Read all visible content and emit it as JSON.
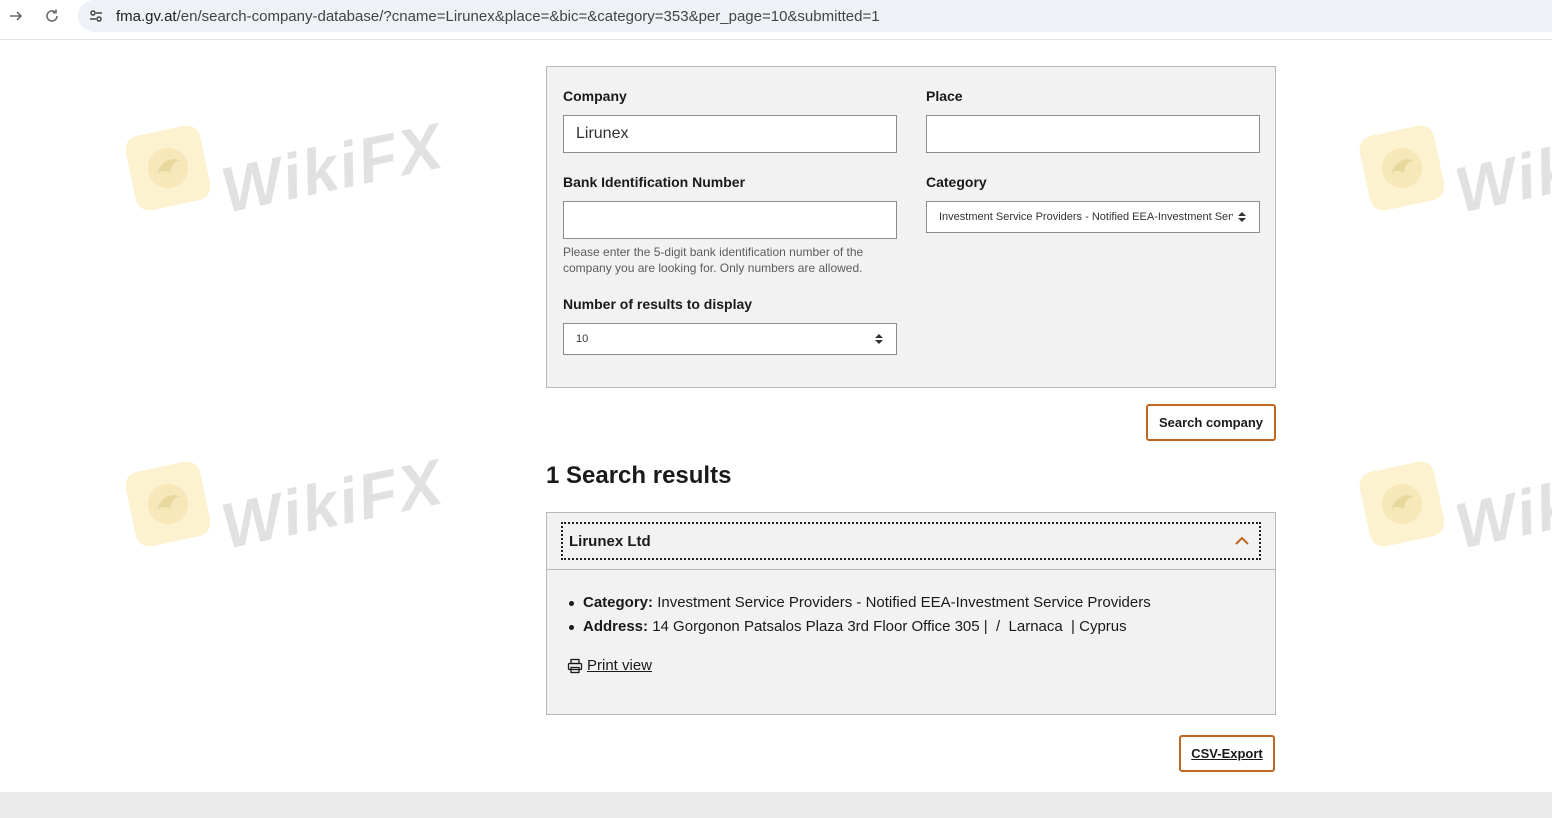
{
  "browser": {
    "url_host": "fma.gv.at",
    "url_path": "/en/search-company-database/?cname=Lirunex&place=&bic=&category=353&per_page=10&submitted=1"
  },
  "form": {
    "company_label": "Company",
    "company_value": "Lirunex",
    "place_label": "Place",
    "place_value": "",
    "bic_label": "Bank Identification Number",
    "bic_value": "",
    "bic_help": "Please enter the 5-digit bank identification number of the company you are looking for. Only numbers are allowed.",
    "category_label": "Category",
    "category_selected": "Investment Service Providers - Notified EEA-Investment Service Providers",
    "results_count_label": "Number of results to display",
    "results_count_selected": "10",
    "search_button": "Search company"
  },
  "results": {
    "title": "1 Search results",
    "items": [
      {
        "name": "Lirunex Ltd",
        "category_label": "Category:",
        "category_value": "Investment Service Providers - Notified EEA-Investment Service Providers",
        "address_label": "Address:",
        "address_value": "14 Gorgonon Patsalos Plaza 3rd Floor Office 305 |  /  Larnaca  | Cyprus",
        "print_label": "Print view"
      }
    ],
    "csv_button": "CSV-Export"
  },
  "watermark": {
    "text": "WikiFX"
  },
  "colors": {
    "accent": "#c0661e",
    "panel_bg": "#f2f2f2",
    "panel_border": "#b8b8b8"
  },
  "icons": {
    "back": "arrow-forward-icon",
    "reload": "reload-icon",
    "site_info": "tune-icon",
    "toggle": "chevron-up-icon",
    "print": "printer-icon"
  }
}
